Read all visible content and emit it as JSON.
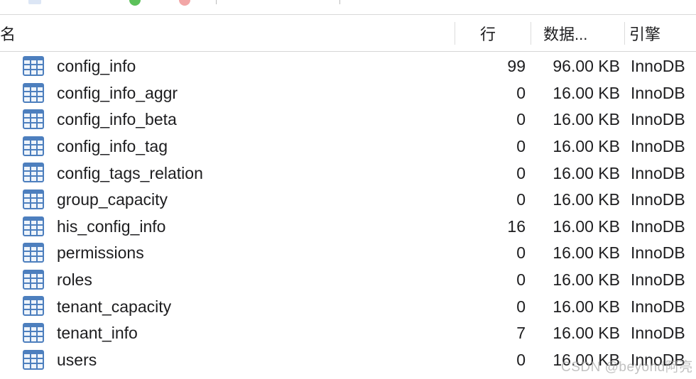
{
  "header": {
    "name": "名",
    "rows": "行",
    "data_size": "数据...",
    "engine": "引擎"
  },
  "tables": [
    {
      "name": "config_info",
      "rows": "99",
      "size": "96.00 KB",
      "engine": "InnoDB"
    },
    {
      "name": "config_info_aggr",
      "rows": "0",
      "size": "16.00 KB",
      "engine": "InnoDB"
    },
    {
      "name": "config_info_beta",
      "rows": "0",
      "size": "16.00 KB",
      "engine": "InnoDB"
    },
    {
      "name": "config_info_tag",
      "rows": "0",
      "size": "16.00 KB",
      "engine": "InnoDB"
    },
    {
      "name": "config_tags_relation",
      "rows": "0",
      "size": "16.00 KB",
      "engine": "InnoDB"
    },
    {
      "name": "group_capacity",
      "rows": "0",
      "size": "16.00 KB",
      "engine": "InnoDB"
    },
    {
      "name": "his_config_info",
      "rows": "16",
      "size": "16.00 KB",
      "engine": "InnoDB"
    },
    {
      "name": "permissions",
      "rows": "0",
      "size": "16.00 KB",
      "engine": "InnoDB"
    },
    {
      "name": "roles",
      "rows": "0",
      "size": "16.00 KB",
      "engine": "InnoDB"
    },
    {
      "name": "tenant_capacity",
      "rows": "0",
      "size": "16.00 KB",
      "engine": "InnoDB"
    },
    {
      "name": "tenant_info",
      "rows": "7",
      "size": "16.00 KB",
      "engine": "InnoDB"
    },
    {
      "name": "users",
      "rows": "0",
      "size": "16.00 KB",
      "engine": "InnoDB"
    }
  ],
  "watermark": "CSDN @beyond阿亮",
  "icons": {
    "table_row_icon": "table-grid-icon"
  },
  "colors": {
    "icon_blue": "#4d7fbe",
    "toolbar_green": "#5cc15a",
    "toolbar_red": "#f2a6a6"
  }
}
